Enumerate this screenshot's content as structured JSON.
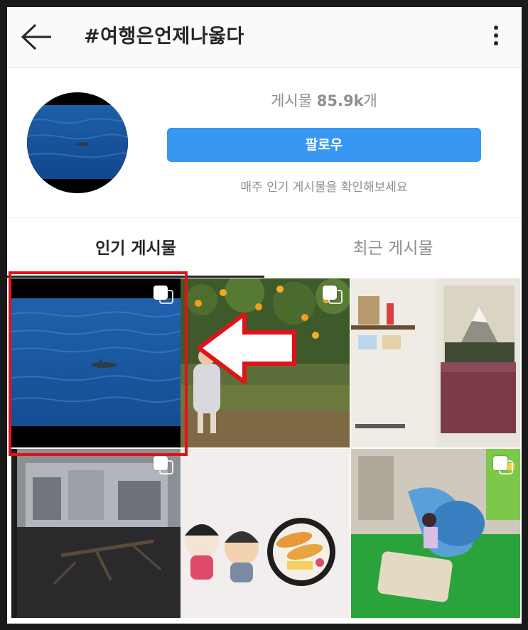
{
  "header": {
    "title": "#여행은언제나옳다",
    "back_icon": "back-arrow-icon",
    "more_icon": "more-vertical-icon"
  },
  "profile": {
    "posts_label": "게시물",
    "posts_count": "85.9k",
    "posts_unit": "개",
    "follow_label": "팔로우",
    "hint": "매주 인기 게시물을 확인해보세요"
  },
  "tabs": [
    {
      "label": "인기 게시물",
      "active": true
    },
    {
      "label": "최근 게시물",
      "active": false
    }
  ],
  "colors": {
    "accent": "#3897f0",
    "highlight": "#e0121a",
    "text": "#262626",
    "muted": "#8e8e8e"
  },
  "grid": [
    {
      "subject": "ocean-dolphin",
      "multi": true,
      "highlighted": true
    },
    {
      "subject": "child-orange-orchard",
      "multi": true,
      "highlighted": false
    },
    {
      "subject": "bedroom-mountain-mural",
      "multi": false,
      "highlighted": false
    },
    {
      "subject": "lobby-driftwood-sculpture",
      "multi": true,
      "highlighted": false
    },
    {
      "subject": "figurines-sushi-bowl",
      "multi": false,
      "highlighted": false
    },
    {
      "subject": "indoor-playground-slide",
      "multi": true,
      "highlighted": false
    }
  ]
}
